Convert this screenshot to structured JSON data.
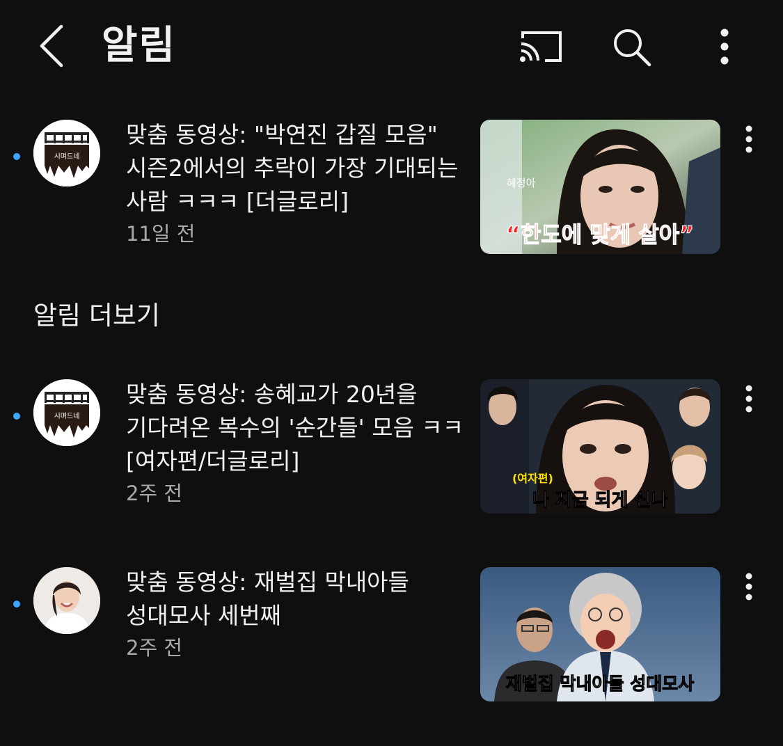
{
  "header": {
    "title": "알림",
    "back_icon": "chevron-left-icon",
    "cast_icon": "cast-icon",
    "search_icon": "search-icon",
    "more_icon": "more-vertical-icon"
  },
  "colors": {
    "background": "#0f0f0f",
    "unread_dot": "#3ea6ff",
    "secondary_text": "#aaaaaa"
  },
  "notifications_top": [
    {
      "title": "맞춤 동영상: \"박연진 갑질 모음\" 시즌2에서의 추락이 가장 기대되는 사람 ㅋㅋㅋ [더글로리]",
      "time": "11일 전",
      "unread": true,
      "avatar_text": "시며드네",
      "thumb_caption_small": "혜정아",
      "thumb_caption": "“한도에 맞게 살아”"
    }
  ],
  "section": {
    "heading": "알림 더보기"
  },
  "notifications_more": [
    {
      "title": "맞춤 동영상: 송혜교가 20년을 기다려온 복수의 '순간들' 모음 ㅋㅋ [여자편/더글로리]",
      "time": "2주 전",
      "unread": true,
      "avatar_text": "시며드네",
      "thumb_caption_small": "(여자편)",
      "thumb_caption": "나 지금 되게 신나"
    },
    {
      "title": "맞춤 동영상: 재벌집 막내아들 성대모사 세번째",
      "time": "2주 전",
      "unread": true,
      "thumb_caption": "재벌집 막내아들 성대모사"
    }
  ]
}
